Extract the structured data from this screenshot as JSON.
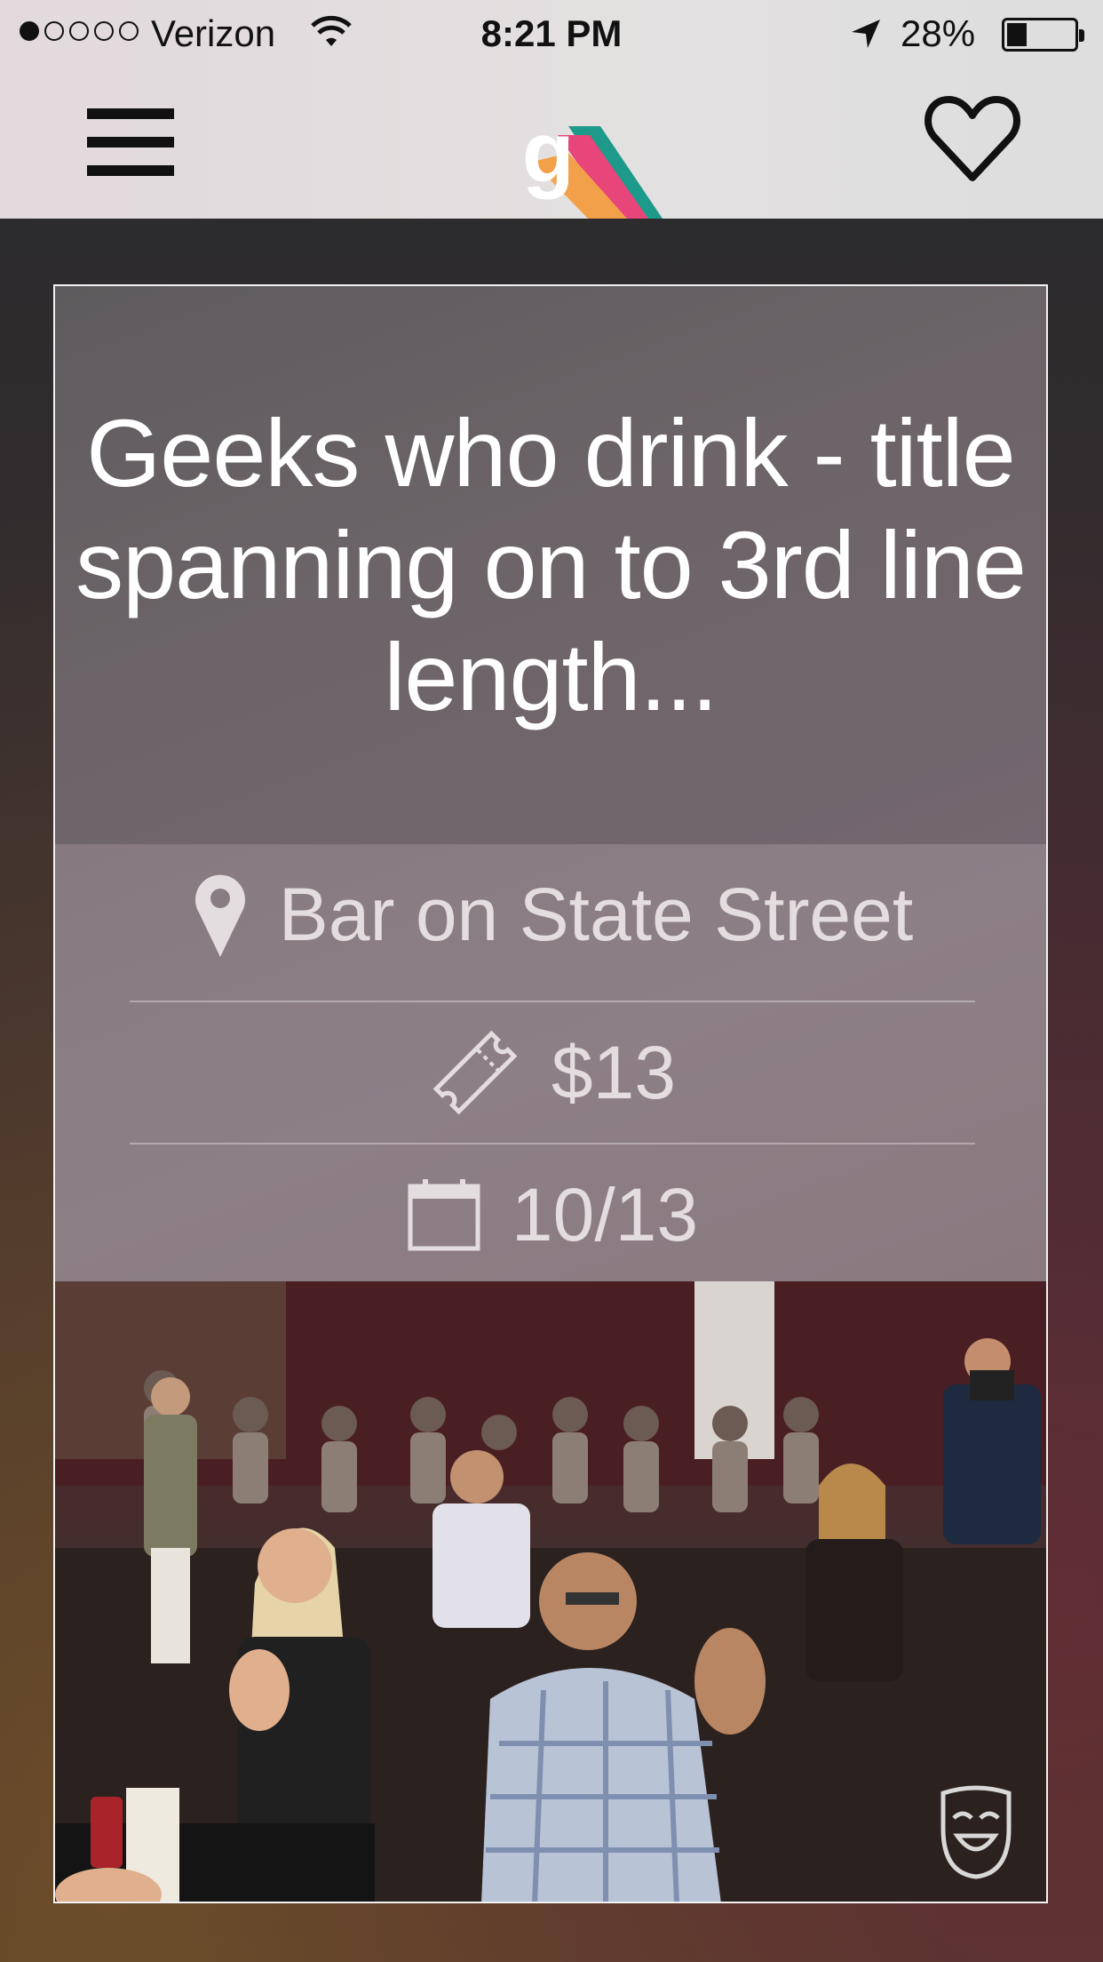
{
  "status_bar": {
    "carrier": "Verizon",
    "time": "8:21 PM",
    "battery": "28%",
    "signal_bars": 1,
    "signal_total": 5
  },
  "header": {
    "menu_icon": "hamburger-menu-icon",
    "logo_letter": "g",
    "favorite_icon": "heart-icon"
  },
  "event": {
    "title": "Geeks who drink - title spanning on to 3rd line length...",
    "location": "Bar on State Street",
    "price": "$13",
    "date": "10/13",
    "photo_description_icon": "theater-mask-icon"
  },
  "colors": {
    "logo_orange": "#f2a14a",
    "logo_pink": "#e8457a",
    "logo_teal": "#1e9a8a"
  }
}
